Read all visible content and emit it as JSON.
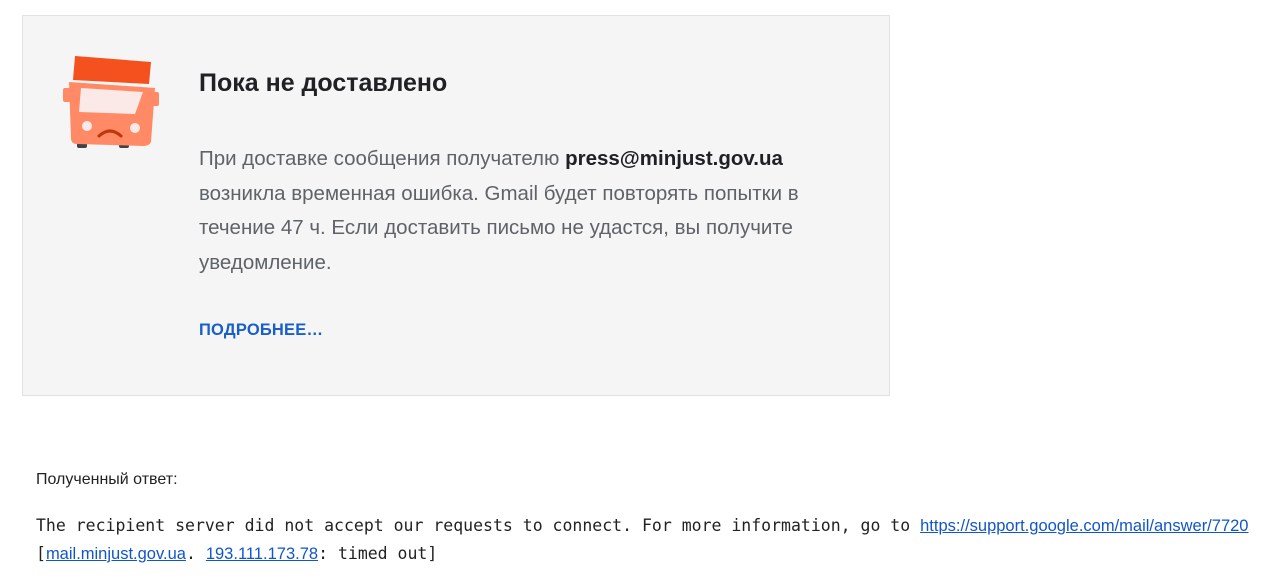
{
  "notice": {
    "icon": "sad-truck-icon",
    "title": "Пока не доставлено",
    "message_before": "При доставке сообщения получателю ",
    "recipient": "press@minjust.gov.ua",
    "message_after": " возникла временная ошибка. Gmail будет повторять попытки в течение 47 ч. Если доставить письмо не удастся, вы получите уведомление.",
    "more_link": "ПОДРОБНЕЕ…"
  },
  "response": {
    "label": "Полученный ответ:",
    "text_before": "The recipient server did not accept our requests to connect. For more information, go to ",
    "help_link": "https://support.google.com/mail/answer/7720",
    "bracket_open": " [",
    "host_link": "mail.minjust.gov.ua",
    "separator": ". ",
    "ip_link": "193.111.173.78",
    "text_after": ": timed out]"
  },
  "colors": {
    "card_background": "#f5f5f5",
    "truck_top": "#f4511e",
    "truck_body": "#ff8a65",
    "link_blue": "#1a5fc8"
  }
}
